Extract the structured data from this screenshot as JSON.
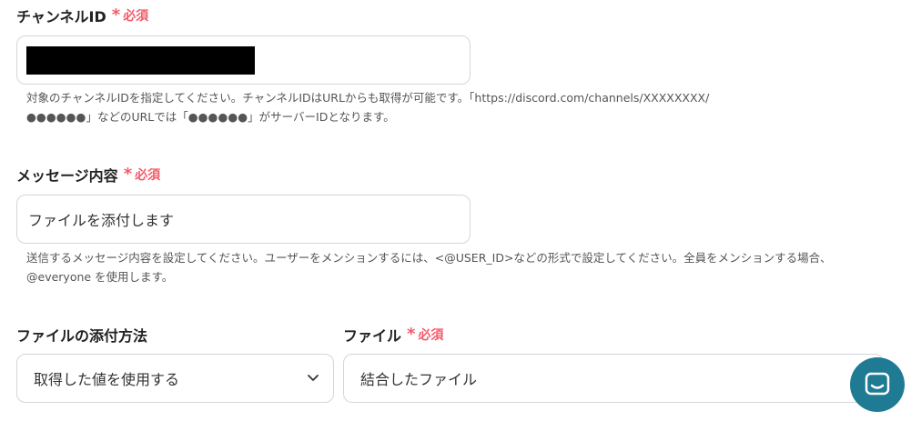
{
  "channel_id": {
    "label": "チャンネルID",
    "required_mark": "*",
    "required_text": "必須",
    "value": "",
    "help_line1": "対象のチャンネルIDを指定してください。チャンネルIDはURLからも取得が可能です。「https://discord.com/channels/XXXXXXXX/",
    "help_line2": "●●●●●●」などのURLでは「●●●●●●」がサーバーIDとなります。"
  },
  "message": {
    "label": "メッセージ内容",
    "required_mark": "*",
    "required_text": "必須",
    "value": "ファイルを添付します",
    "help_line1": "送信するメッセージ内容を設定してください。ユーザーをメンションするには、<@USER_ID>などの形式で設定してください。全員をメンションする場合、",
    "help_line2": "@everyone を使用します。"
  },
  "attach_method": {
    "label": "ファイルの添付方法",
    "selected": "取得した値を使用する"
  },
  "file": {
    "label": "ファイル",
    "required_mark": "*",
    "required_text": "必須",
    "value": "結合したファイル"
  },
  "colors": {
    "required": "#f25c6a",
    "chat_button": "#1f7a94",
    "border": "#d3d6da"
  },
  "icons": {
    "dropdown": "chevron-down-icon",
    "chat": "chat-bubble-icon"
  }
}
